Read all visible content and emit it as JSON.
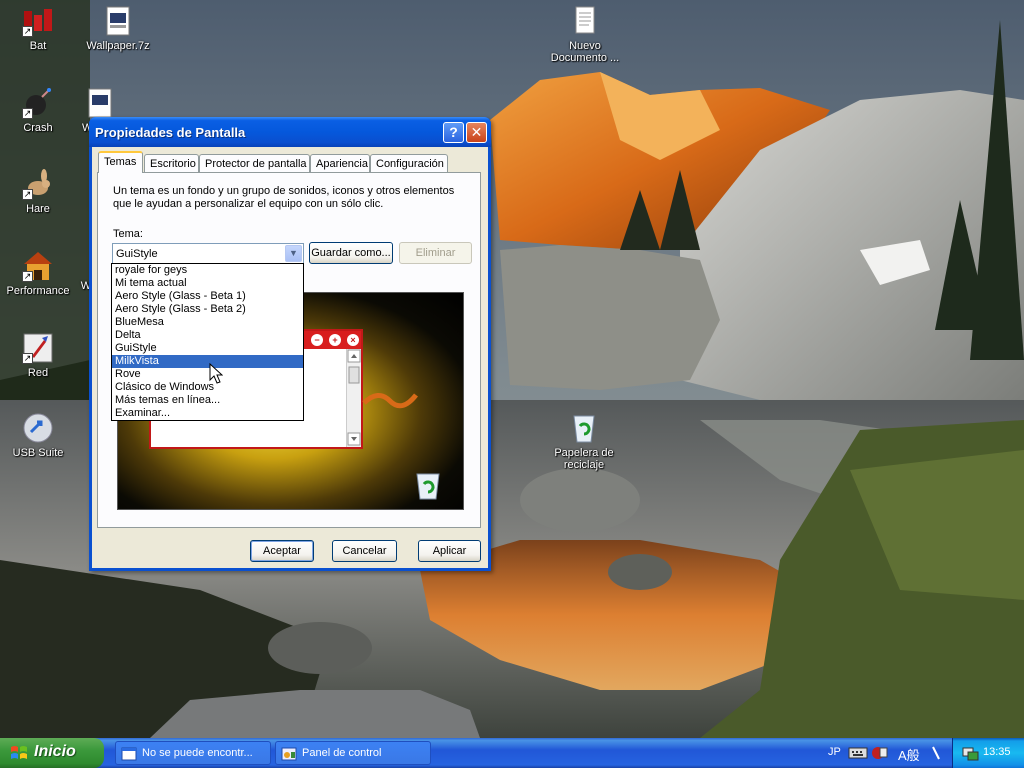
{
  "desktop": {
    "icons": [
      {
        "label": "Bat"
      },
      {
        "label": "Wallpaper.7z"
      },
      {
        "label": "Nuevo Documento ..."
      },
      {
        "label": "Crash"
      },
      {
        "label": "W"
      },
      {
        "label": "Hare"
      },
      {
        "label": "Performance"
      },
      {
        "label": "W"
      },
      {
        "label": "Red"
      },
      {
        "label": "USB Suite"
      },
      {
        "label": "Papelera de reciclaje"
      }
    ]
  },
  "dialog": {
    "title": "Propiedades de Pantalla",
    "help_button": "?",
    "close_button": "✕",
    "tabs": [
      {
        "label": "Temas",
        "active": true
      },
      {
        "label": "Escritorio"
      },
      {
        "label": "Protector de pantalla"
      },
      {
        "label": "Apariencia"
      },
      {
        "label": "Configuración"
      }
    ],
    "description": "Un tema es un fondo y un grupo de sonidos, iconos y otros elementos que le ayudan a personalizar el equipo con un sólo clic.",
    "tema_label": "Tema:",
    "tema_value": "GuiStyle",
    "save_button": "Guardar como...",
    "delete_button": "Eliminar",
    "dropdown_items": [
      "royale for geys",
      "Mi tema actual",
      "Aero Style (Glass - Beta 1)",
      "Aero Style (Glass - Beta 2)",
      "BlueMesa",
      "Delta",
      "GuiStyle",
      "MilkVista",
      "Rove",
      "Clásico de Windows",
      "Más temas en línea...",
      "Examinar..."
    ],
    "dropdown_selected": "MilkVista",
    "ok_button": "Aceptar",
    "cancel_button": "Cancelar",
    "apply_button": "Aplicar"
  },
  "taskbar": {
    "start_label": "Inicio",
    "tasks": [
      {
        "label": "No se puede encontr..."
      },
      {
        "label": "Panel de control"
      }
    ],
    "language": "JP",
    "ime_text": "A般",
    "clock": "13:35"
  },
  "colors": {
    "selection": "#316ac5",
    "title_blue": "#0558dc",
    "taskbar_blue": "#2157d7",
    "start_green": "#3c993c"
  }
}
